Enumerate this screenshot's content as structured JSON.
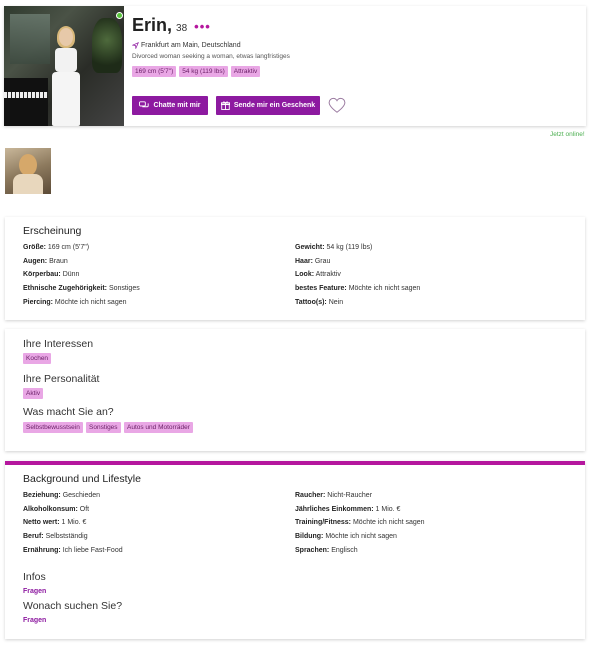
{
  "profile": {
    "name": "Erin,",
    "age": "38",
    "location": "Frankfurt am Main, Deutschland",
    "seeking": "Divorced woman seeking a woman, etwas langfristiges",
    "tags": [
      "169 cm (5'7\")",
      "54 kg (119 lbs)",
      "Attraktiv"
    ],
    "chat_label": "Chatte mit mir",
    "gift_label": "Sende mir ein Geschenk",
    "online_status": "Jetzt online!"
  },
  "appearance": {
    "title": "Erscheinung",
    "left": [
      {
        "label": "Größe:",
        "value": "169 cm (5'7\")"
      },
      {
        "label": "Augen:",
        "value": "Braun"
      },
      {
        "label": "Körperbau:",
        "value": "Dünn"
      },
      {
        "label": "Ethnische Zugehörigkeit:",
        "value": "Sonstiges"
      },
      {
        "label": "Piercing:",
        "value": "Möchte ich nicht sagen"
      }
    ],
    "right": [
      {
        "label": "Gewicht:",
        "value": "54 kg (119 lbs)"
      },
      {
        "label": "Haar:",
        "value": "Grau"
      },
      {
        "label": "Look:",
        "value": "Attraktiv"
      },
      {
        "label": "bestes Feature:",
        "value": "Möchte ich nicht sagen"
      },
      {
        "label": "Tattoo(s):",
        "value": "Nein"
      }
    ]
  },
  "interests": {
    "interests_title": "Ihre Interessen",
    "interests": [
      "Kochen"
    ],
    "personality_title": "Ihre Personalität",
    "personality": [
      "Aktiv"
    ],
    "work_title": "Was macht Sie an?",
    "work": [
      "Selbstbewusstsein",
      "Sonstiges",
      "Autos und Motorräder"
    ]
  },
  "background": {
    "title": "Background und Lifestyle",
    "left": [
      {
        "label": "Beziehung:",
        "value": "Geschieden"
      },
      {
        "label": "Alkoholkonsum:",
        "value": "Oft"
      },
      {
        "label": "Netto wert:",
        "value": "1 Mio. €"
      },
      {
        "label": "Beruf:",
        "value": "Selbstständig"
      },
      {
        "label": "Ernährung:",
        "value": "Ich liebe Fast-Food"
      }
    ],
    "right": [
      {
        "label": "Raucher:",
        "value": "Nicht-Raucher"
      },
      {
        "label": "Jährliches Einkommen:",
        "value": "1 Mio. €"
      },
      {
        "label": "Training/Fitness:",
        "value": "Möchte ich nicht sagen"
      },
      {
        "label": "Bildung:",
        "value": "Möchte ich nicht sagen"
      },
      {
        "label": "Sprachen:",
        "value": "Englisch"
      }
    ],
    "infos_title": "Infos",
    "infos_link": "Fragen",
    "seeking_title": "Wonach suchen Sie?",
    "seeking_link": "Fragen"
  },
  "colors": {
    "accent": "#8d1aa0",
    "tag_bg": "#e9a7e5",
    "online": "#4caf50"
  }
}
